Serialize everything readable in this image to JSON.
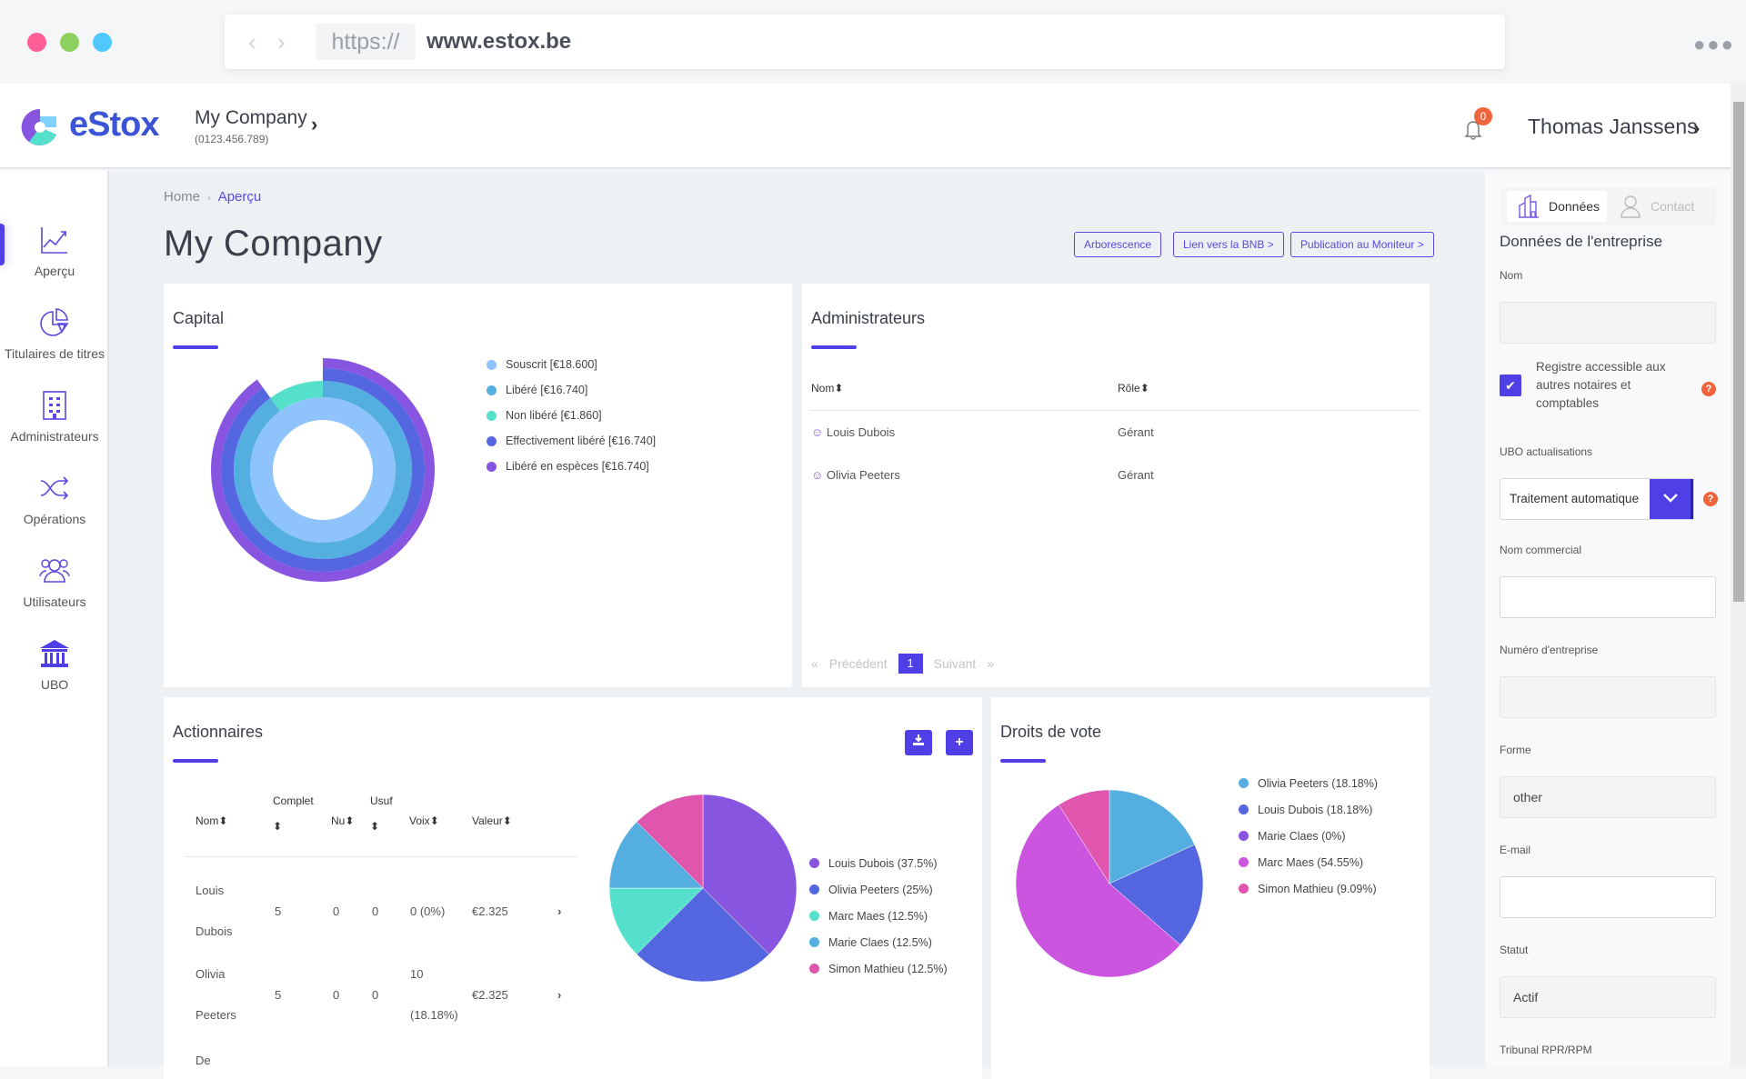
{
  "browser": {
    "protocol": "https://",
    "host": "www.estox.be",
    "back_icon": "chevron-left",
    "forward_icon": "chevron-right",
    "more_icon": "ellipsis",
    "traffic_colors": [
      "#ff5f97",
      "#8ed05f",
      "#4fc8ff"
    ]
  },
  "header": {
    "brand": "eStox",
    "company_name": "My Company",
    "company_number": "(0123.456.789)",
    "notification_count": "0",
    "user_name": "Thomas Janssens"
  },
  "sidebar": {
    "items": [
      {
        "label": "Aperçu",
        "icon": "chart-line-icon",
        "active": true
      },
      {
        "label": "Titulaires de titres",
        "icon": "pie-chart-icon",
        "active": false
      },
      {
        "label": "Administrateurs",
        "icon": "building-icon",
        "active": false
      },
      {
        "label": "Opérations",
        "icon": "shuffle-icon",
        "active": false
      },
      {
        "label": "Utilisateurs",
        "icon": "users-icon",
        "active": false
      },
      {
        "label": "UBO",
        "icon": "bank-icon",
        "active": false
      }
    ]
  },
  "breadcrumb": {
    "home": "Home",
    "separator": "›",
    "current": "Aperçu"
  },
  "page": {
    "title": "My Company",
    "buttons": {
      "tree": "Arborescence",
      "bnb": "Lien vers la BNB >",
      "moniteur": "Publication au Moniteur >"
    }
  },
  "capital": {
    "title": "Capital"
  },
  "administrateurs": {
    "title": "Administrateurs",
    "columns": [
      "Nom",
      "Rôle"
    ],
    "sort_icon": "⬍",
    "rows": [
      {
        "name": "Louis Dubois",
        "role": "Gérant"
      },
      {
        "name": "Olivia Peeters",
        "role": "Gérant"
      }
    ],
    "pagination": {
      "first": "«",
      "prev": "Précédent",
      "page": "1",
      "next": "Suivant",
      "last": "»"
    }
  },
  "actionnaires": {
    "title": "Actionnaires",
    "columns": {
      "nom": "Nom",
      "complet": "Complet",
      "nu": "Nu",
      "usuf": "Usuf",
      "voix": "Voix",
      "valeur": "Valeur"
    },
    "rows": [
      {
        "first": "Louis",
        "last": "Dubois",
        "complet": "5",
        "nu": "0",
        "usuf": "0",
        "voix_a": "0 (0%)",
        "voix_b": "",
        "valeur": "€2.325"
      },
      {
        "first": "Olivia",
        "last": "Peeters",
        "complet": "5",
        "nu": "0",
        "usuf": "0",
        "voix_a": "10",
        "voix_b": "(18.18%)",
        "valeur": "€2.325"
      },
      {
        "first": "De",
        "last": "",
        "complet": "",
        "nu": "",
        "usuf": "",
        "voix_a": "",
        "voix_b": "",
        "valeur": ""
      }
    ],
    "download_icon": "download-icon",
    "add_icon": "plus-icon"
  },
  "droits": {
    "title": "Droits de vote"
  },
  "chart_data": [
    {
      "type": "pie",
      "title": "Capital",
      "variant": "concentric-radial-rings",
      "total": 18600,
      "series": [
        {
          "name": "Souscrit",
          "label": "Souscrit [€18.600]",
          "value": 18600,
          "color": "#8ec4fb"
        },
        {
          "name": "Libéré",
          "label": "Libéré [€16.740]",
          "value": 16740,
          "color": "#55aee0"
        },
        {
          "name": "Non libéré",
          "label": "Non libéré [€1.860]",
          "value": 1860,
          "color": "#55e0cc"
        },
        {
          "name": "Effectivement libéré",
          "label": "Effectivement libéré [€16.740]",
          "value": 16740,
          "color": "#5567e0"
        },
        {
          "name": "Libéré en espèces",
          "label": "Libéré en espèces [€16.740]",
          "value": 16740,
          "color": "#8855e0"
        }
      ],
      "legend": "right"
    },
    {
      "type": "pie",
      "title": "Actionnaires",
      "series": [
        {
          "name": "Louis Dubois",
          "label": "Louis Dubois (37.5%)",
          "value": 37.5,
          "color": "#8855e0"
        },
        {
          "name": "Olivia Peeters",
          "label": "Olivia Peeters (25%)",
          "value": 25,
          "color": "#5567e0"
        },
        {
          "name": "Marc Maes",
          "label": "Marc Maes (12.5%)",
          "value": 12.5,
          "color": "#55e0cc"
        },
        {
          "name": "Marie Claes",
          "label": "Marie Claes (12.5%)",
          "value": 12.5,
          "color": "#55aee0"
        },
        {
          "name": "Simon Mathieu",
          "label": "Simon Mathieu (12.5%)",
          "value": 12.5,
          "color": "#e055ad"
        }
      ],
      "legend": "right"
    },
    {
      "type": "pie",
      "title": "Droits de vote",
      "series": [
        {
          "name": "Olivia Peeters",
          "label": "Olivia Peeters (18.18%)",
          "value": 18.18,
          "color": "#55aee0"
        },
        {
          "name": "Louis Dubois",
          "label": "Louis Dubois (18.18%)",
          "value": 18.18,
          "color": "#5567e0"
        },
        {
          "name": "Marie Claes",
          "label": "Marie Claes (0%)",
          "value": 0,
          "color": "#8855e0"
        },
        {
          "name": "Marc Maes",
          "label": "Marc Maes (54.55%)",
          "value": 54.55,
          "color": "#cc55e0"
        },
        {
          "name": "Simon Mathieu",
          "label": "Simon Mathieu (9.09%)",
          "value": 9.09,
          "color": "#e055ad"
        }
      ],
      "legend": "top-right"
    }
  ],
  "panel": {
    "tabs": {
      "data": "Données",
      "contact": "Contact"
    },
    "title": "Données de l'entreprise",
    "fields": {
      "nom": {
        "label": "Nom",
        "value": ""
      },
      "registre": {
        "label": "Registre accessible aux autres notaires et comptables",
        "checked": true
      },
      "ubo": {
        "label": "UBO actualisations",
        "value": "Traitement automatique"
      },
      "commercial": {
        "label": "Nom commercial",
        "value": ""
      },
      "numero": {
        "label": "Numéro d'entreprise",
        "value": ""
      },
      "forme": {
        "label": "Forme",
        "value": "other"
      },
      "email": {
        "label": "E-mail",
        "value": ""
      },
      "statut": {
        "label": "Statut",
        "value": "Actif"
      },
      "tribunal": {
        "label": "Tribunal RPR/RPM"
      }
    },
    "help": "?",
    "check": "✔"
  }
}
